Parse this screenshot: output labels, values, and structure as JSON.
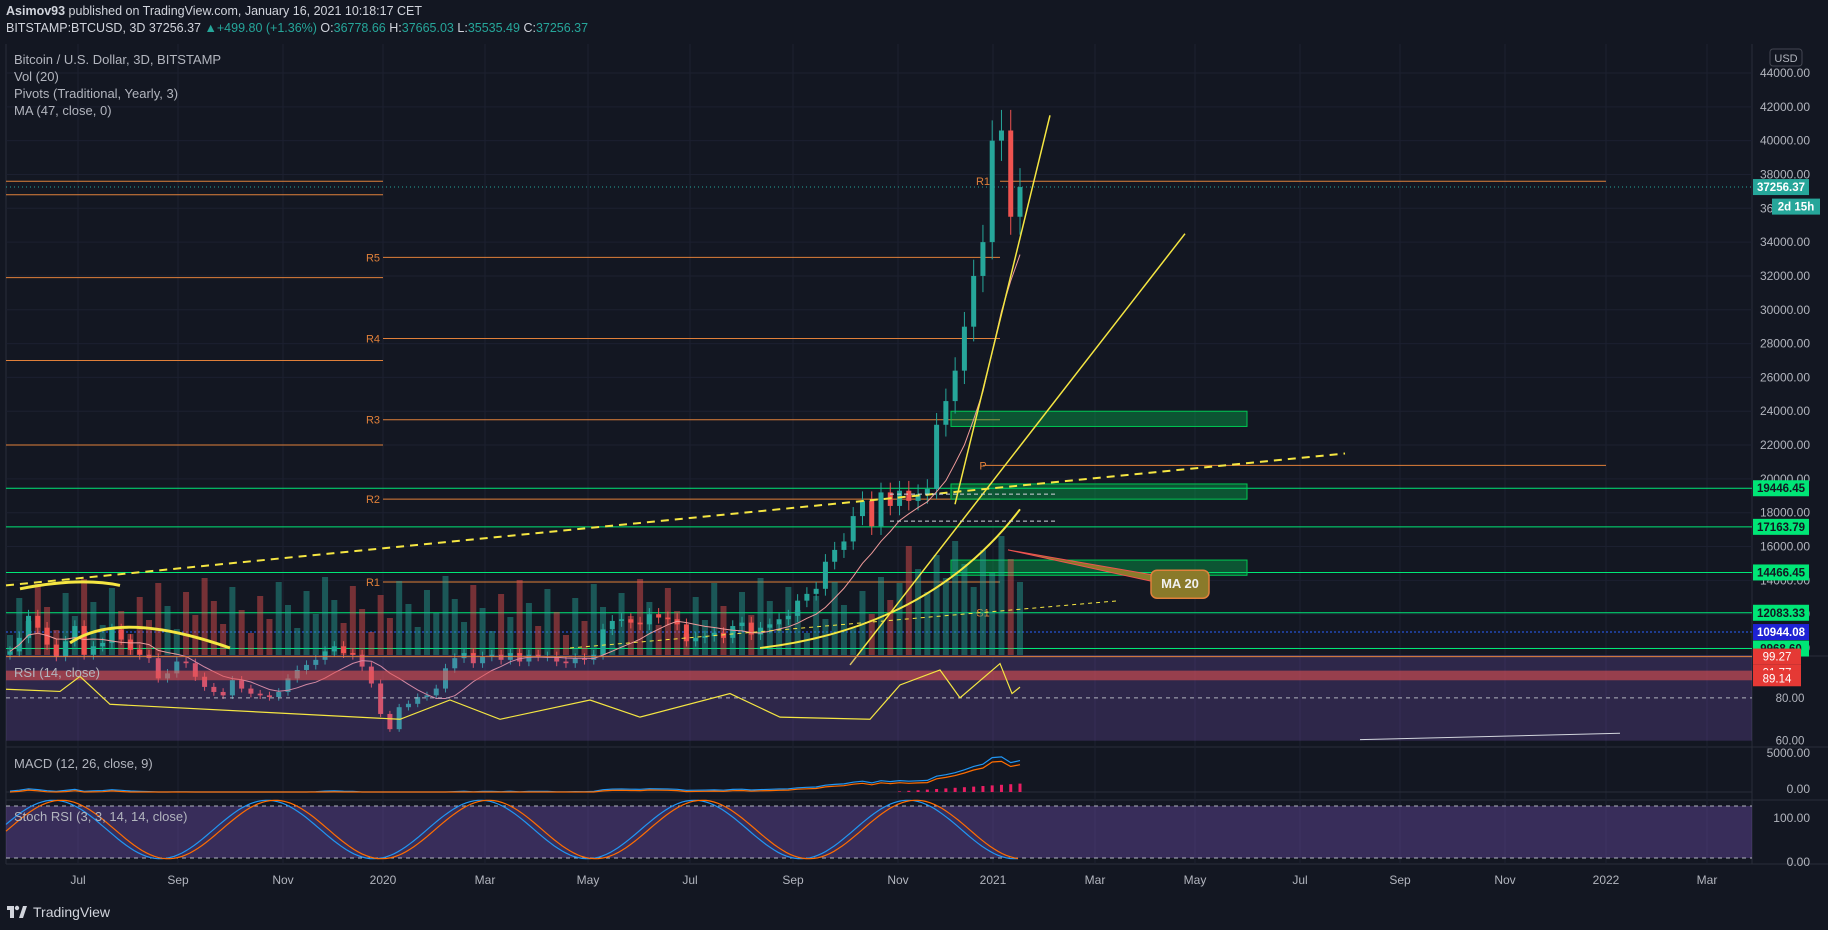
{
  "header": {
    "author": "Asimov93",
    "published": "published on TradingView.com, January 16, 2021 10:18:17 CET",
    "symbol": "BITSTAMP:BTCUSD, 3D",
    "last": "37256.37",
    "change": "+499.80 (+1.36%)",
    "o_label": "O:",
    "o": "36778.66",
    "h_label": "H:",
    "h": "37665.03",
    "l_label": "L:",
    "l": "35535.49",
    "c_label": "C:",
    "c": "37256.37"
  },
  "legends": {
    "title": "Bitcoin / U.S. Dollar, 3D, BITSTAMP",
    "vol": "Vol (20)",
    "pivots": "Pivots (Traditional, Yearly, 3)",
    "ma": "MA (47, close, 0)",
    "rsi": "RSI (14, close)",
    "macd": "MACD (12, 26, close, 9)",
    "stoch": "Stoch RSI (3, 3, 14, 14, close)"
  },
  "footer": {
    "brand": "TradingView"
  },
  "chart_data": {
    "type": "candlestick",
    "currency": "USD",
    "price_ticks": [
      44000,
      42000,
      40000,
      38000,
      36000,
      34000,
      32000,
      30000,
      28000,
      26000,
      24000,
      22000,
      20000,
      18000,
      16000,
      14000,
      12000,
      10000
    ],
    "price_tick_labels": [
      "44000.00",
      "42000.00",
      "40000.00",
      "38000.00",
      "36000.00",
      "34000.00",
      "32000.00",
      "30000.00",
      "28000.00",
      "26000.00",
      "24000.00",
      "22000.00",
      "20000.00",
      "18000.00",
      "16000.00",
      "14000.00",
      "12000.00",
      "10000.00"
    ],
    "x_labels": [
      "Jul",
      "Sep",
      "Nov",
      "2020",
      "Mar",
      "May",
      "Jul",
      "Sep",
      "Nov",
      "2021",
      "Mar",
      "May",
      "Jul",
      "Sep",
      "Nov",
      "2022",
      "Mar"
    ],
    "price_tags": [
      {
        "label": "37256.37",
        "value": 37256.37,
        "color": "#26a69a"
      },
      {
        "label": "2d 15h",
        "value": 36100,
        "color": "#26a69a"
      },
      {
        "label": "19446.45",
        "value": 19446.45,
        "color": "#00e676"
      },
      {
        "label": "17163.79",
        "value": 17163.79,
        "color": "#00e676"
      },
      {
        "label": "14466.45",
        "value": 14466.45,
        "color": "#00e676"
      },
      {
        "label": "12083.33",
        "value": 12083.33,
        "color": "#00e676"
      },
      {
        "label": "10944.08",
        "value": 10944.08,
        "color": "#1e22d4"
      },
      {
        "label": "9968.60",
        "value": 9968.6,
        "color": "#00e676"
      }
    ],
    "pivots": [
      {
        "label": "R5",
        "value": 33100
      },
      {
        "label": "R4",
        "value": 28300
      },
      {
        "label": "R3",
        "value": 23500
      },
      {
        "label": "R2",
        "value": 18800
      },
      {
        "label": "R1",
        "value": 13900
      },
      {
        "label": "R1",
        "value": 37600
      },
      {
        "label": "P",
        "value": 20800
      },
      {
        "label": "S1",
        "value": 12100
      }
    ],
    "zones": [
      {
        "from": 23100,
        "to": 24000
      },
      {
        "from": 18800,
        "to": 19700
      },
      {
        "from": 14300,
        "to": 15200
      }
    ],
    "annotation": "MA 20",
    "rsi": {
      "ticks": [
        "99.27",
        "91.77",
        "89.14",
        "80.00",
        "60.00"
      ],
      "values": [
        99.27,
        91.77,
        89.14,
        80,
        60
      ]
    },
    "macd": {
      "ticks": [
        "5000.00",
        "0.00"
      ]
    },
    "stoch": {
      "ticks": [
        "100.00",
        "0.00"
      ]
    },
    "candles_close": [
      9800,
      10600,
      11900,
      11200,
      10200,
      9500,
      10400,
      11300,
      9600,
      10100,
      10300,
      11100,
      10500,
      9900,
      9600,
      9400,
      8200,
      8500,
      9200,
      9100,
      8300,
      7700,
      7400,
      7200,
      8100,
      7600,
      7300,
      7200,
      7100,
      7400,
      8200,
      8700,
      9000,
      9300,
      9800,
      10100,
      9700,
      9600,
      8900,
      7900,
      6100,
      5200,
      6500,
      6700,
      7100,
      7200,
      7600,
      8800,
      9400,
      9700,
      9100,
      9500,
      9600,
      9300,
      9700,
      9200,
      9600,
      9500,
      9500,
      9200,
      9100,
      9400,
      9300,
      9600,
      11100,
      11600,
      11700,
      11500,
      11400,
      12000,
      11800,
      11700,
      11400,
      10400,
      10600,
      10700,
      10900,
      10600,
      11300,
      11500,
      10800,
      11200,
      11400,
      11700,
      11900,
      12800,
      13200,
      13500,
      15100,
      15800,
      16300,
      17800,
      18700,
      17200,
      19200,
      18400,
      19300,
      18700,
      19100,
      19400,
      23200,
      24600,
      26400,
      29000,
      32000,
      34000,
      40000,
      40600,
      35500,
      37256
    ]
  }
}
